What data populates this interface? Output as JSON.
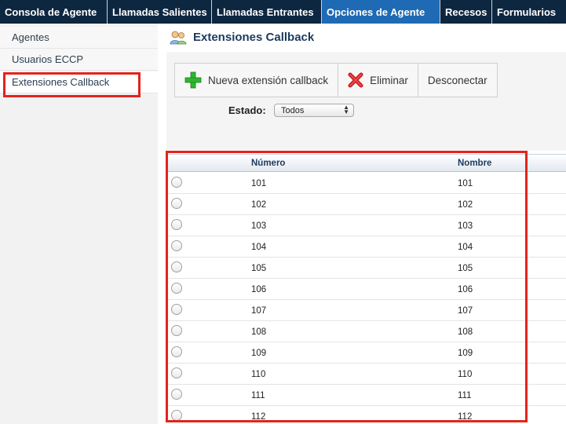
{
  "nav": {
    "tabs": [
      {
        "label": "Consola de Agente"
      },
      {
        "label": "Llamadas Salientes"
      },
      {
        "label": "Llamadas Entrantes"
      },
      {
        "label": "Opciones de Agente"
      },
      {
        "label": "Recesos"
      },
      {
        "label": "Formularios"
      }
    ],
    "active_tab": "Opciones de Agente"
  },
  "sidebar": {
    "items": [
      {
        "label": "Agentes"
      },
      {
        "label": "Usuarios ECCP"
      },
      {
        "label": "Extensiones Callback"
      }
    ],
    "active_item": "Extensiones Callback"
  },
  "page": {
    "title": "Extensiones Callback",
    "icon": "users-icon"
  },
  "toolbar": {
    "new_label": "Nueva extensión callback",
    "delete_label": "Eliminar",
    "disconnect_label": "Desconectar"
  },
  "filter": {
    "label": "Estado:",
    "selected": "Todos"
  },
  "table": {
    "columns": [
      "Número",
      "Nombre"
    ],
    "rows": [
      {
        "numero": "101",
        "nombre": "101"
      },
      {
        "numero": "102",
        "nombre": "102"
      },
      {
        "numero": "103",
        "nombre": "103"
      },
      {
        "numero": "104",
        "nombre": "104"
      },
      {
        "numero": "105",
        "nombre": "105"
      },
      {
        "numero": "106",
        "nombre": "106"
      },
      {
        "numero": "107",
        "nombre": "107"
      },
      {
        "numero": "108",
        "nombre": "108"
      },
      {
        "numero": "109",
        "nombre": "109"
      },
      {
        "numero": "110",
        "nombre": "110"
      },
      {
        "numero": "111",
        "nombre": "111"
      },
      {
        "numero": "112",
        "nombre": "112"
      }
    ]
  },
  "colors": {
    "nav_bg": "#0d2740",
    "nav_active": "#1f6ab4",
    "highlight": "#e3241b",
    "title": "#1d3a5f"
  }
}
